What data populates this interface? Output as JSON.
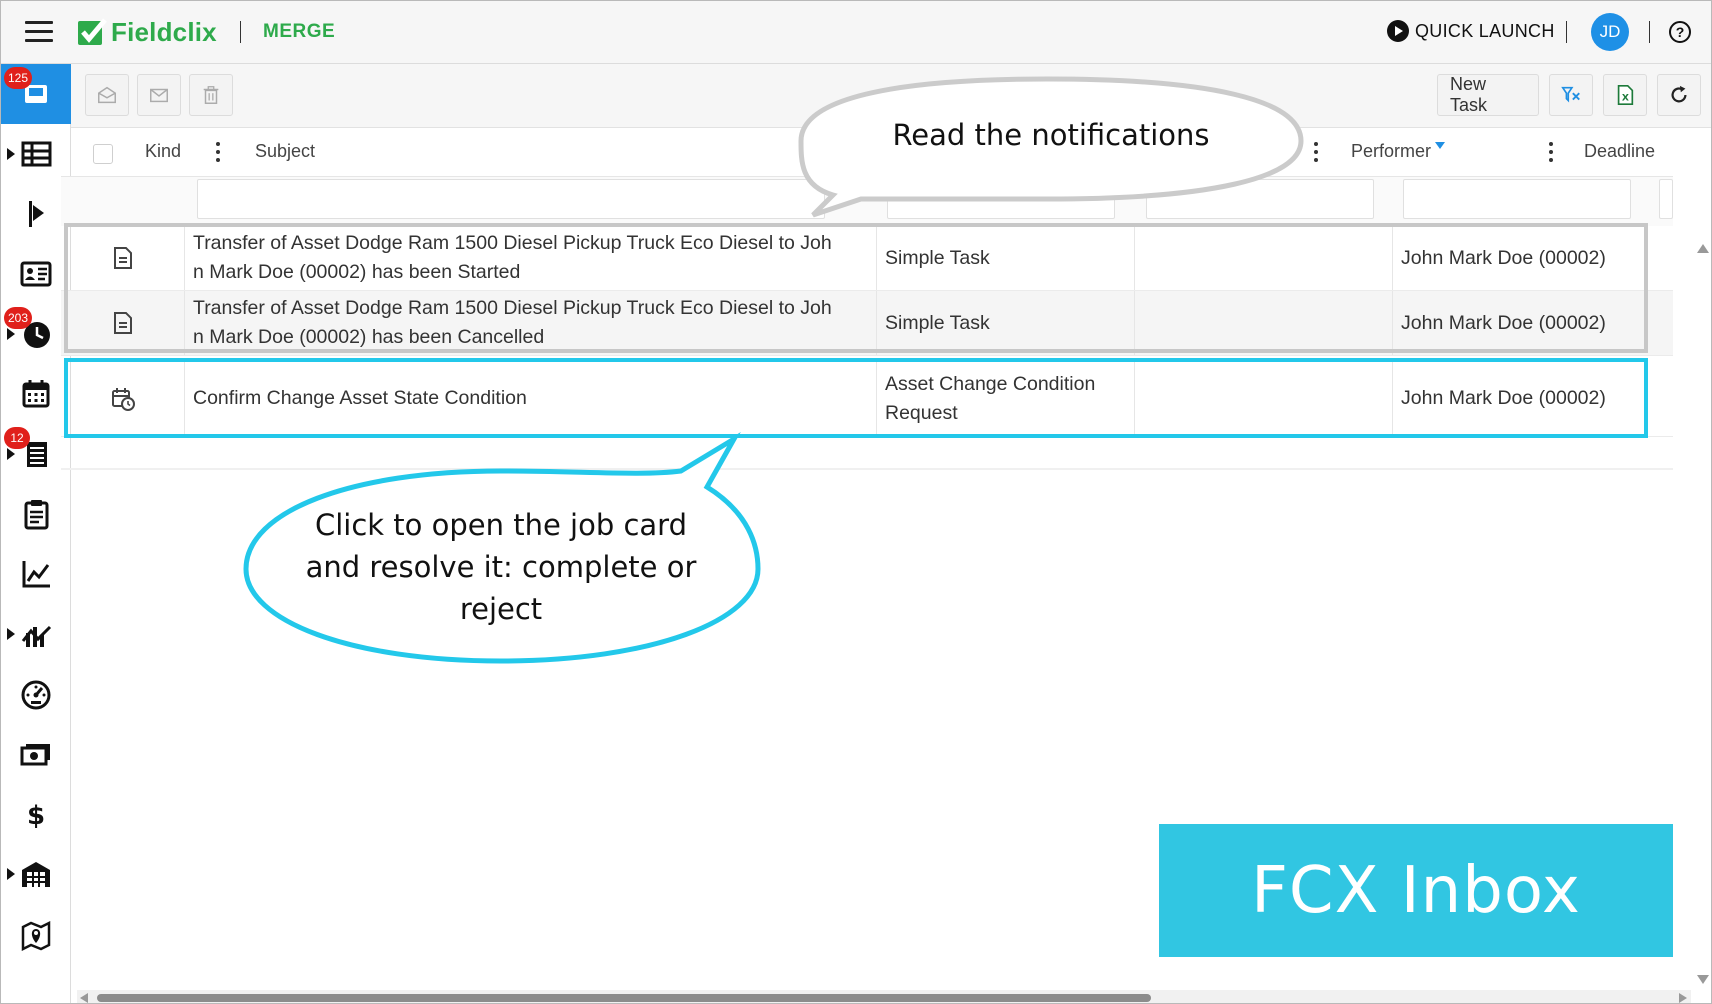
{
  "app": {
    "brand": "Fieldclix",
    "module": "MERGE",
    "quick_launch": "QUICK LAUNCH",
    "user_initials": "JD",
    "help_label": "?"
  },
  "colors": {
    "brand_green": "#2eaa4b",
    "accent_blue": "#1f8fe3",
    "badge_red": "#e0201b",
    "callout_cyan": "#23c8ea",
    "banner_cyan": "#31c6e2"
  },
  "sidebar": {
    "items": [
      {
        "icon": "inbox-icon",
        "badge": "125",
        "active": true,
        "expandable": false
      },
      {
        "icon": "table-grid-icon",
        "badge": "",
        "active": false,
        "expandable": true
      },
      {
        "icon": "flag-play-icon",
        "badge": "",
        "active": false,
        "expandable": false
      },
      {
        "icon": "contact-card-icon",
        "badge": "",
        "active": false,
        "expandable": false
      },
      {
        "icon": "clock-icon",
        "badge": "203",
        "active": false,
        "expandable": true
      },
      {
        "icon": "calendar-icon",
        "badge": "",
        "active": false,
        "expandable": false
      },
      {
        "icon": "document-list-icon",
        "badge": "12",
        "active": false,
        "expandable": true
      },
      {
        "icon": "clipboard-icon",
        "badge": "",
        "active": false,
        "expandable": false
      },
      {
        "icon": "line-chart-icon",
        "badge": "",
        "active": false,
        "expandable": false
      },
      {
        "icon": "bar-trend-icon",
        "badge": "",
        "active": false,
        "expandable": true
      },
      {
        "icon": "gauge-icon",
        "badge": "",
        "active": false,
        "expandable": false
      },
      {
        "icon": "money-icon",
        "badge": "",
        "active": false,
        "expandable": false
      },
      {
        "icon": "dollar-icon",
        "badge": "",
        "active": false,
        "expandable": false
      },
      {
        "icon": "warehouse-icon",
        "badge": "",
        "active": false,
        "expandable": true
      },
      {
        "icon": "map-pin-icon",
        "badge": "",
        "active": false,
        "expandable": false
      }
    ]
  },
  "toolbar": {
    "mark_read": "envelope-open-icon",
    "mark_unread": "envelope-icon",
    "delete": "trash-icon",
    "new_task_label": "New Task",
    "clear_filter": "clear-filter-icon",
    "export_excel": "excel-icon",
    "refresh": "refresh-icon"
  },
  "grid": {
    "columns": {
      "kind": "Kind",
      "subject": "Subject",
      "performer": "Performer",
      "deadline": "Deadline"
    },
    "rows": [
      {
        "kind_icon": "document-icon",
        "subject_line1": "Transfer of Asset Dodge Ram 1500 Diesel Pickup Truck Eco Diesel to Joh",
        "subject_line2": "n Mark Doe (00002) has been Started",
        "type_line1": "Simple Task",
        "type_line2": "",
        "status": "",
        "performer": "John Mark Doe (00002)"
      },
      {
        "kind_icon": "document-icon",
        "subject_line1": "Transfer of Asset Dodge Ram 1500 Diesel Pickup Truck Eco Diesel to Joh",
        "subject_line2": "n Mark Doe (00002) has been Cancelled",
        "type_line1": "Simple Task",
        "type_line2": "",
        "status": "",
        "performer": "John Mark Doe (00002)"
      },
      {
        "kind_icon": "calendar-clock-icon",
        "subject_line1": "Confirm Change Asset State Condition",
        "subject_line2": "",
        "type_line1": "Asset Change Condition",
        "type_line2": "Request",
        "status": "",
        "performer": "John Mark Doe (00002)"
      }
    ]
  },
  "callouts": {
    "top": "Read the notifications",
    "bottom_line1": "Click to open the job card",
    "bottom_line2": "and resolve it: complete or",
    "bottom_line3": "reject"
  },
  "banner": {
    "label": "FCX Inbox"
  }
}
